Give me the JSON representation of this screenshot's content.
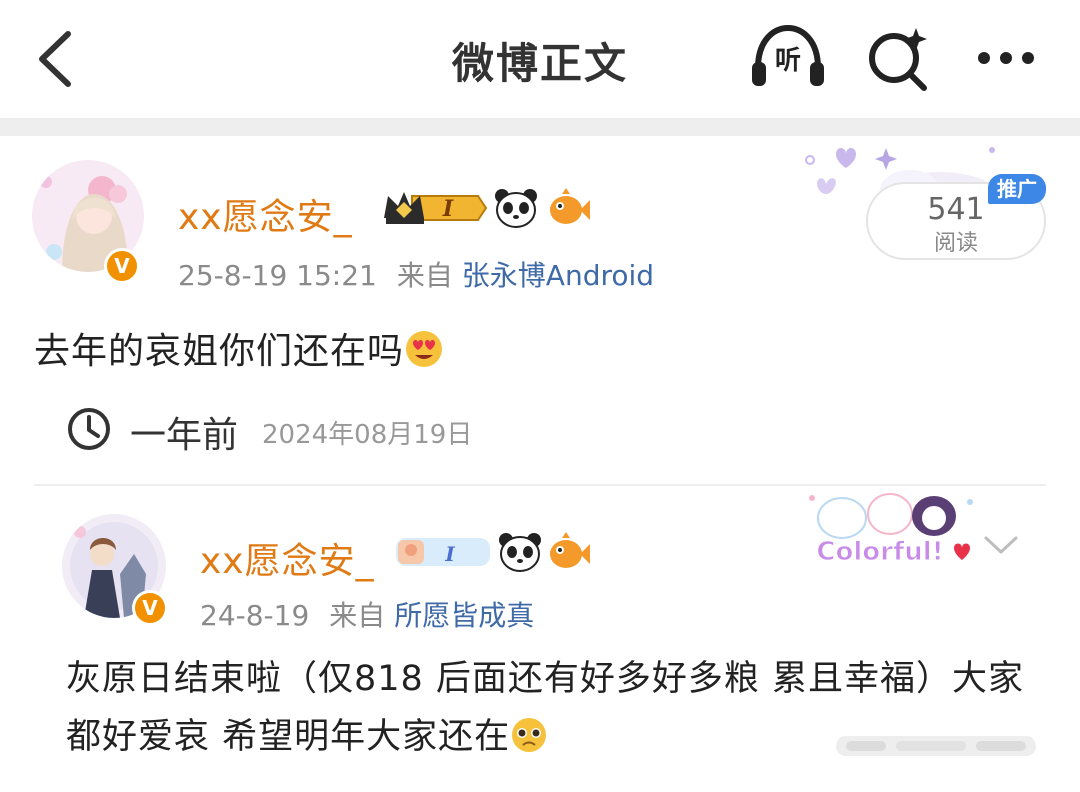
{
  "header": {
    "title": "微博正文",
    "listen_label": "听"
  },
  "post": {
    "username": "xx愿念安_",
    "level_badge": "I",
    "time": "25-8-19 15:21",
    "from_label": "来自",
    "source": "张永博Android",
    "read_count": "541",
    "read_label": "阅读",
    "promo_label": "推广",
    "text": "去年的哀姐你们还在吗",
    "relative_time": "一年前",
    "absolute_date": "2024年08月19日"
  },
  "quoted_post": {
    "username": "xx愿念安_",
    "level_badge": "I",
    "time": "24-8-19",
    "from_label": "来自",
    "source": "所愿皆成真",
    "colorful_label": "Colorful!",
    "text": "灰原日结束啦（仅818 后面还有好多好多粮 累且幸福）大家都好爱哀 希望明年大家还在"
  },
  "colors": {
    "username": "#e07a14",
    "source_link": "#3f6aa8",
    "verified": "#f29100",
    "promo": "#3d87e6"
  },
  "icons": [
    "back-arrow-icon",
    "headphones-icon",
    "search-sparkle-icon",
    "more-dots-icon",
    "clock-icon",
    "chevron-down-icon",
    "panda-icon",
    "fish-icon",
    "crown-icon",
    "heart-eyes-emoji",
    "pleading-emoji"
  ]
}
